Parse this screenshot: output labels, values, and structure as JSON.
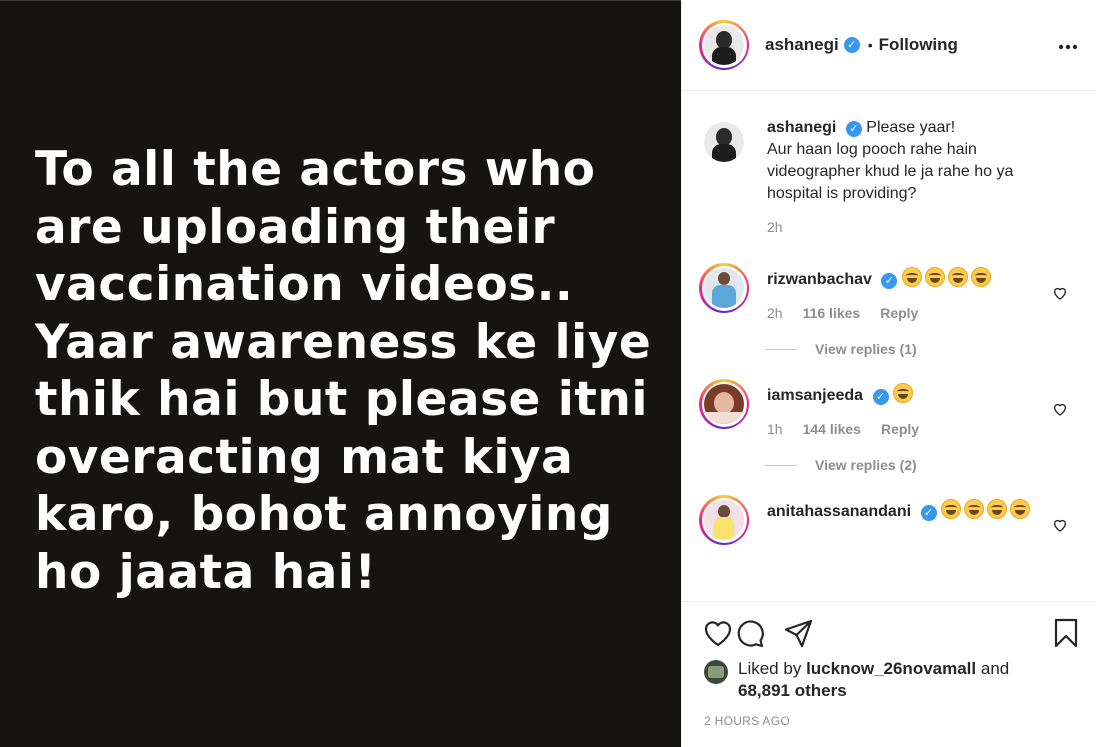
{
  "post": {
    "image_text": "To all the actors who\nare uploading their\nvaccination videos..\nYaar awareness ke liye\nthik hai but please itni\noveracting mat kiya\nkaro, bohot annoying\nho jaata hai!",
    "image_bg": "#161412"
  },
  "header": {
    "username": "ashanegi",
    "verified_mark": "✓",
    "dot": "•",
    "following_label": "Following",
    "more_label": "..."
  },
  "caption": {
    "username": "ashanegi",
    "text": "Please yaar!\nAur haan log pooch rahe hain videographer khud le ja rahe ho ya hospital is providing?",
    "time": "2h"
  },
  "comments": [
    {
      "username": "rizwanbachav",
      "emoji_count": 4,
      "time": "2h",
      "likes": "116 likes",
      "reply": "Reply",
      "view_replies": "View replies (1)"
    },
    {
      "username": "iamsanjeeda",
      "emoji_count": 1,
      "time": "1h",
      "likes": "144 likes",
      "reply": "Reply",
      "view_replies": "View replies (2)"
    },
    {
      "username": "anitahassanandani",
      "emoji_count": 4,
      "time": "",
      "likes": "",
      "reply": "",
      "view_replies": ""
    }
  ],
  "actions": {
    "liked_prefix": "Liked by",
    "liked_user": "lucknow_26novamall",
    "liked_and": "and",
    "liked_others": "68,891 others",
    "timestamp": "2 HOURS AGO"
  },
  "icons": {
    "like": "heart-icon",
    "comment": "comment-bubble-icon",
    "share": "paper-plane-icon",
    "save": "bookmark-icon",
    "more": "more-dots-icon",
    "verified": "verified-badge-icon",
    "emoji": "tears-of-joy-emoji"
  },
  "colors": {
    "verified": "#3897f0",
    "muted_text": "#8e8e8e",
    "primary_text": "#262626",
    "border": "#efefef"
  }
}
